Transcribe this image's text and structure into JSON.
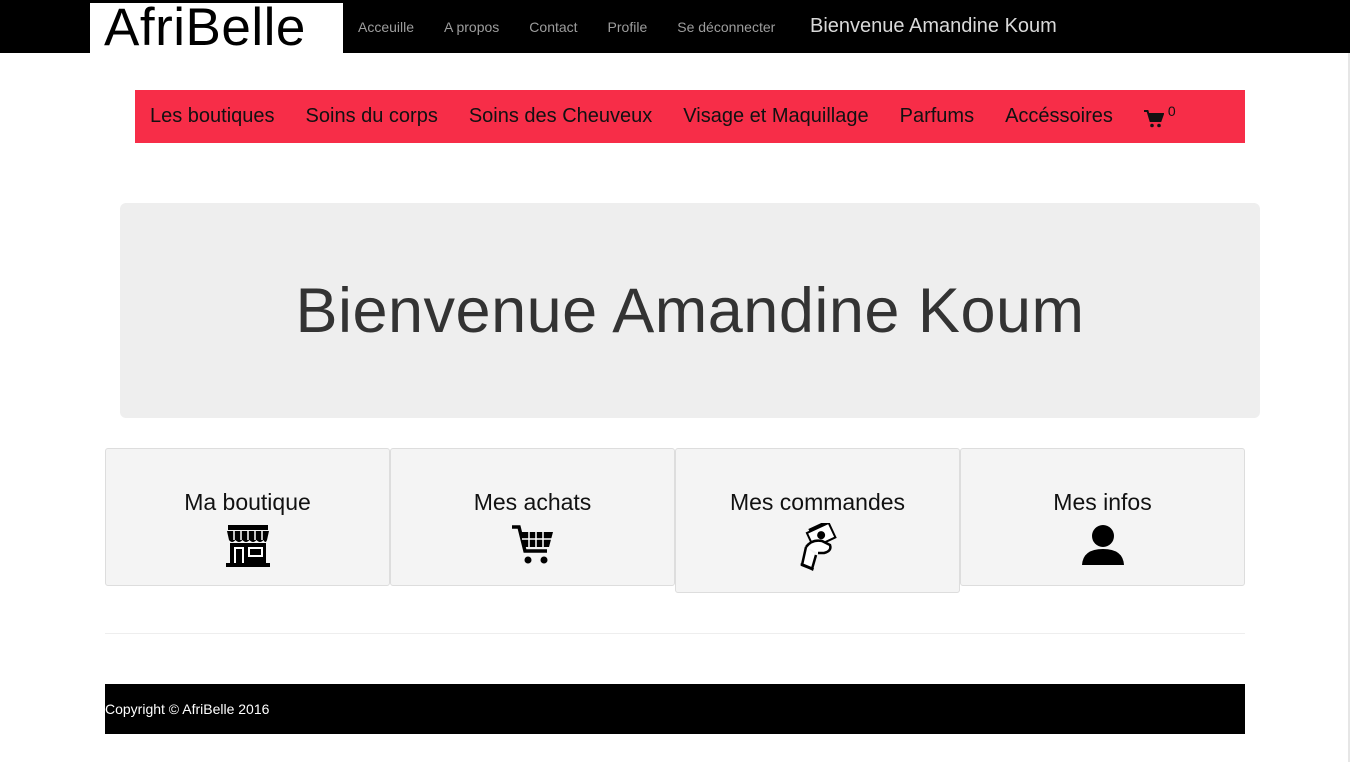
{
  "brand": {
    "logo_text": "AfriBelle"
  },
  "topnav": {
    "items": [
      {
        "label": "Acceuille"
      },
      {
        "label": "A propos"
      },
      {
        "label": "Contact"
      },
      {
        "label": "Profile"
      },
      {
        "label": "Se déconnecter"
      }
    ],
    "welcome": "Bienvenue Amandine Koum"
  },
  "catnav": {
    "items": [
      {
        "label": "Les boutiques"
      },
      {
        "label": "Soins du corps"
      },
      {
        "label": "Soins des Cheuveux"
      },
      {
        "label": "Visage et Maquillage"
      },
      {
        "label": "Parfums"
      },
      {
        "label": "Accéssoires"
      }
    ],
    "cart_count": "0"
  },
  "jumbotron": {
    "heading": "Bienvenue Amandine Koum"
  },
  "cards": [
    {
      "title": "Ma boutique",
      "icon": "storefront-icon"
    },
    {
      "title": "Mes achats",
      "icon": "shopping-cart-icon"
    },
    {
      "title": "Mes commandes",
      "icon": "hand-money-icon"
    },
    {
      "title": "Mes infos",
      "icon": "user-icon"
    }
  ],
  "footer": {
    "copyright": "Copyright © AfriBelle 2016"
  },
  "colors": {
    "topbar": "#000000",
    "catnav": "#f72d48",
    "jumbotron": "#eeeeee",
    "card": "#f4f4f4",
    "footer": "#000000"
  }
}
